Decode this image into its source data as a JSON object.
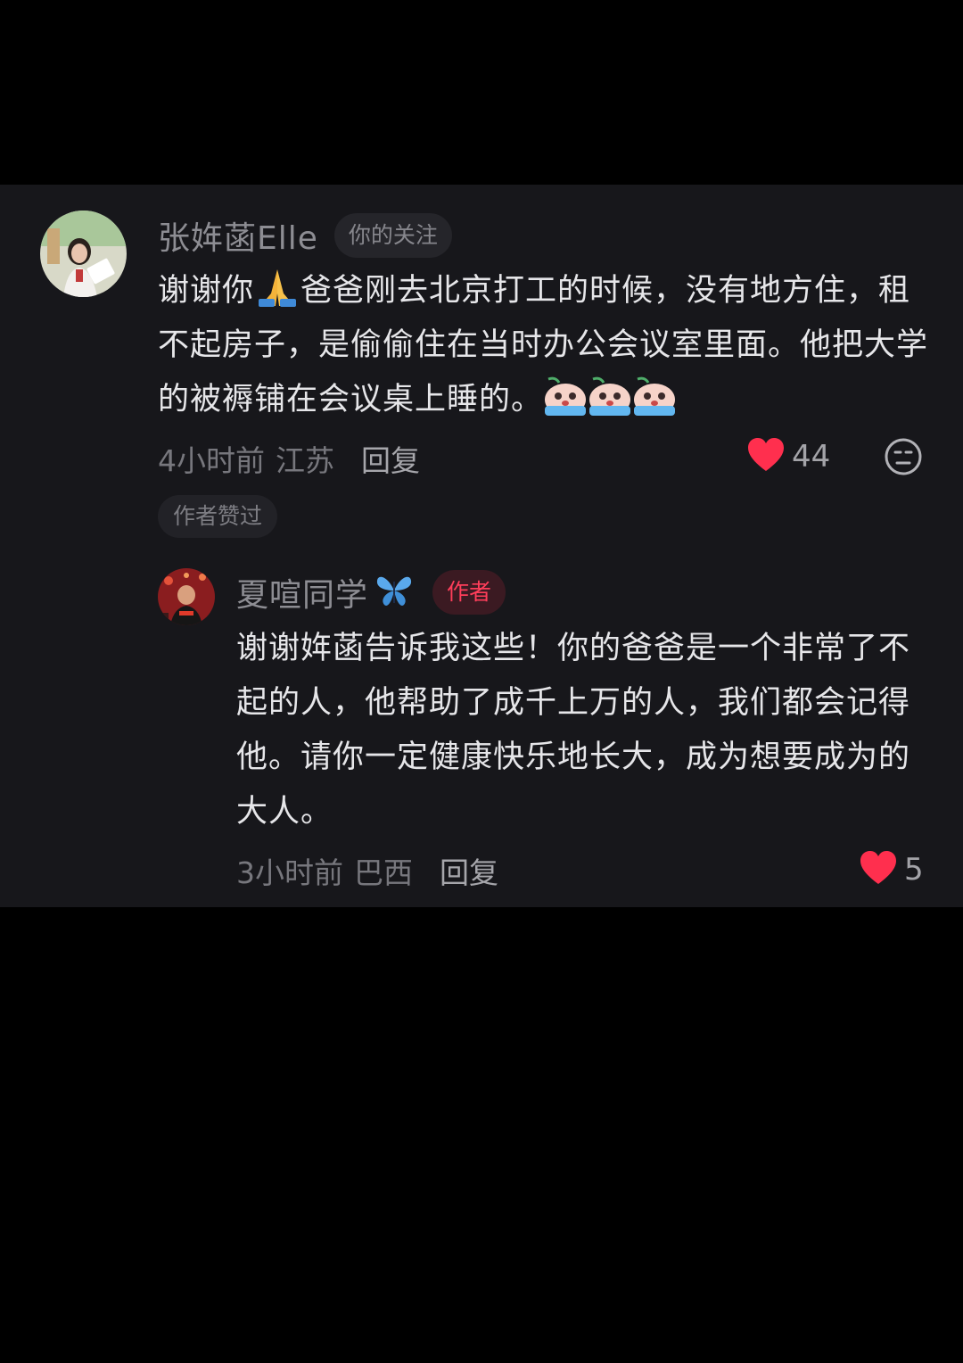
{
  "comment": {
    "username": "张姩菡Elle",
    "follow_tag": "你的关注",
    "text_part1": "谢谢你",
    "text_part2": "爸爸刚去北京打工的时候，没有地方住，租不起房子，是偷偷住在当时办公会议室里面。他把大学的被褥铺在会议桌上睡的。",
    "inline_emojis": [
      "folded-hands-emoji",
      "crying-emoji",
      "crying-emoji",
      "crying-emoji"
    ],
    "time": "4小时前",
    "location": "江苏",
    "reply_label": "回复",
    "likes": "44",
    "liked_by_author": "作者赞过"
  },
  "reply": {
    "username": "夏喧同学",
    "name_emoji": "blue-butterfly-emoji",
    "author_tag": "作者",
    "text": "谢谢姩菡告诉我这些！你的爸爸是一个非常了不起的人，他帮助了成千上万的人，我们都会记得他。请你一定健康快乐地长大，成为想要成为的大人。",
    "time": "3小时前",
    "location": "巴西",
    "reply_label": "回复",
    "likes": "5"
  },
  "colors": {
    "panel_background": "#17171b",
    "like_heart": "#ff2f4e",
    "author_tag_text": "#ff3e5a"
  }
}
